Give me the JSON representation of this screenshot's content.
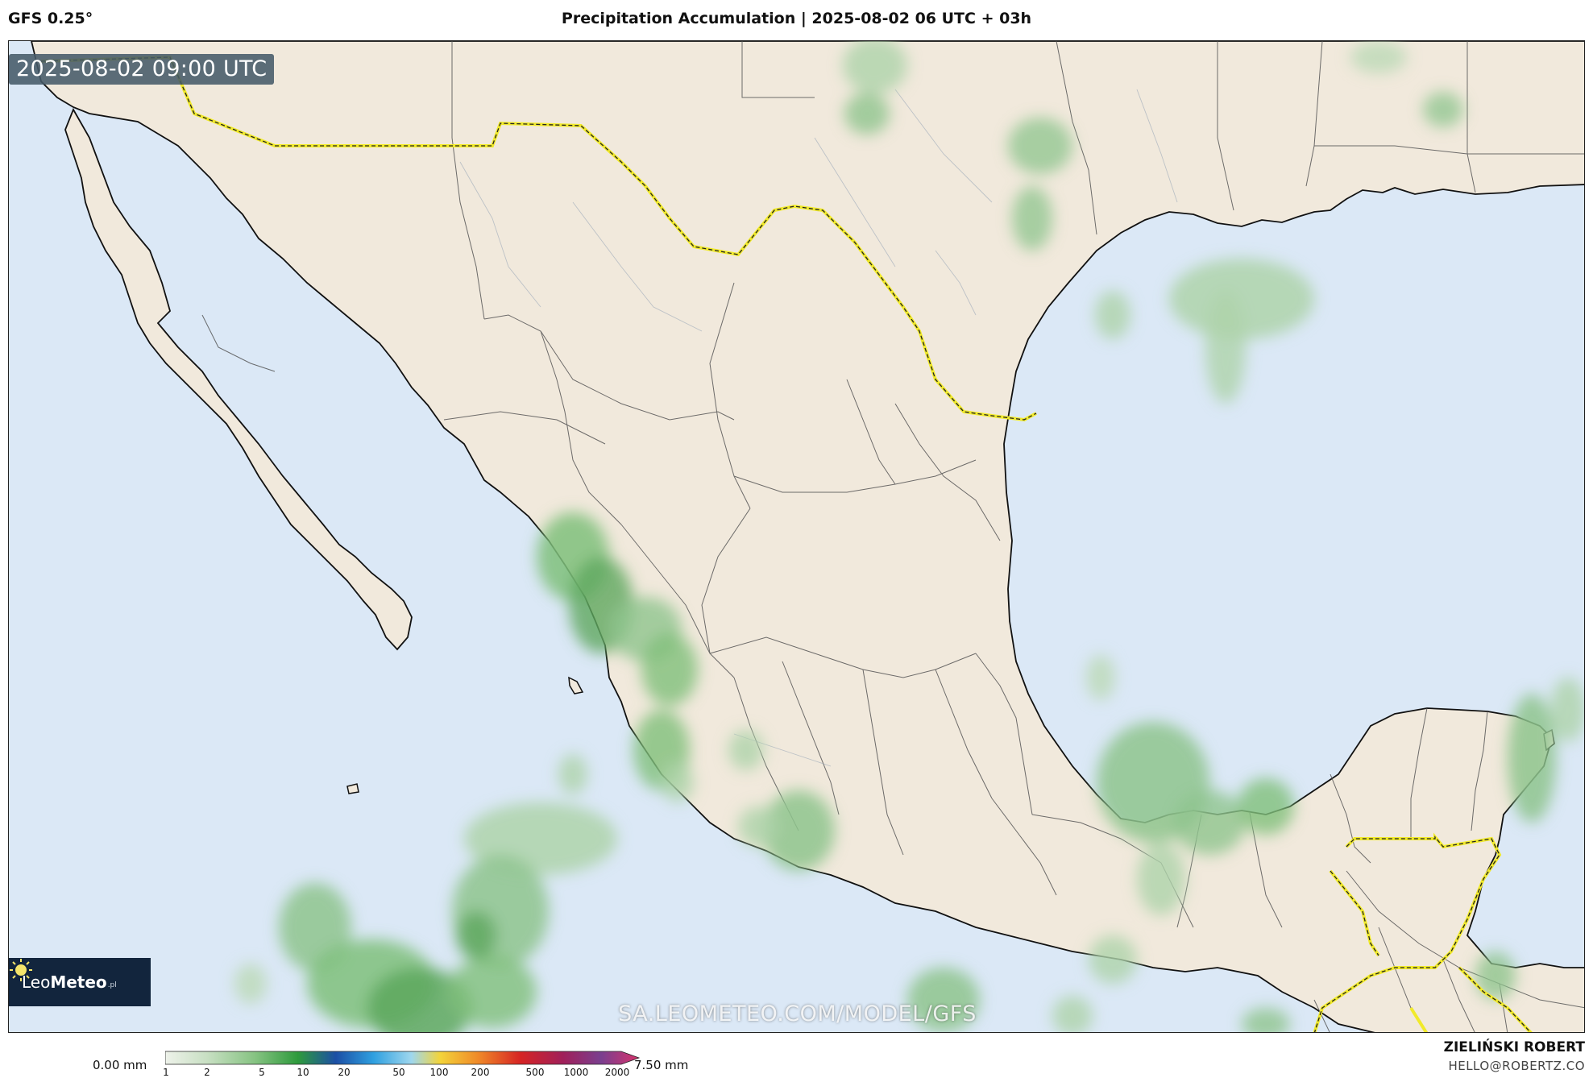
{
  "header": {
    "model": "GFS 0.25°",
    "title": "Precipitation Accumulation | 2025-08-02 06 UTC + 03h"
  },
  "map": {
    "timestamp": "2025-08-02 09:00 UTC",
    "watermark": "SA.LEOMETEO.COM/MODEL/GFS",
    "logo": {
      "name_light": "Leo",
      "name_bold": "Meteo",
      "suffix": ".pl"
    },
    "colors": {
      "land": "#f1e9dc",
      "ocean": "#dbe8f6",
      "border": "#e8e000",
      "precip_light": "#c6dfc3",
      "precip_mid": "#8ec48d",
      "precip_dark": "#4f9f56"
    }
  },
  "legend": {
    "min_label": "0.00 mm",
    "max_label": "7.50 mm",
    "ticks": [
      "1",
      "2",
      "5",
      "10",
      "20",
      "50",
      "100",
      "200",
      "500",
      "1000",
      "2000"
    ],
    "colors": [
      "#e8eee4",
      "#bcd9b6",
      "#7fbf7b",
      "#2e9a3c",
      "#1a5aa8",
      "#2fa0e0",
      "#f3d43a",
      "#f08a28",
      "#d62424",
      "#a0205a",
      "#7a3f8f",
      "#d6336c"
    ]
  },
  "credits": {
    "author": "ZIELIŃSKI ROBERT",
    "email": "HELLO@ROBERTZ.CO"
  }
}
